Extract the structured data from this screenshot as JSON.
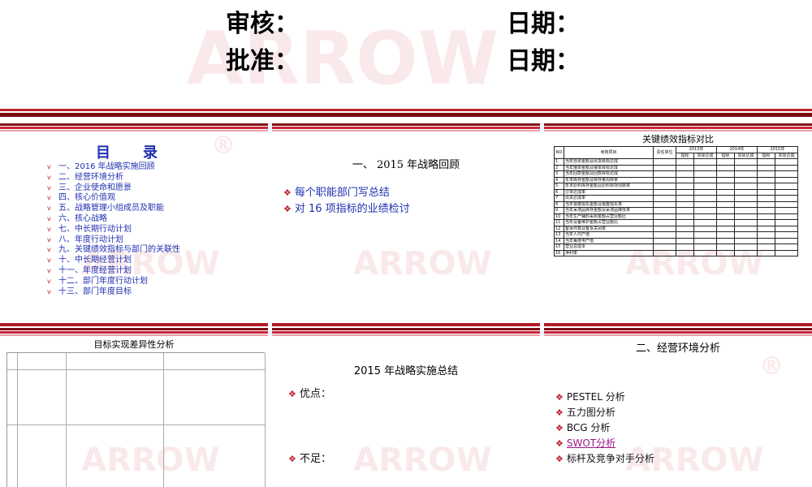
{
  "header": {
    "review_label": "审核：",
    "review_date_label": "日期：",
    "approve_label": "批准：",
    "approve_date_label": "日期："
  },
  "watermark": {
    "brand": "ARROW",
    "mark": "®"
  },
  "toc_slide": {
    "title": "目录",
    "items": [
      "一、2016 年战略实施回顾",
      "二、经营环境分析",
      "三、企业使命和愿景",
      "四、核心价值观",
      "五、战略管理小组成员及职能",
      "六、核心战略",
      "七、中长期行动计划",
      "八、年度行动计划",
      "九、关键绩效指标与部门的关联性",
      "十、中长期经营计划",
      "十一、年度经营计划",
      "十二、部门年度行动计划",
      "十三、部门年度目标"
    ],
    "bullet": "v"
  },
  "review_slide": {
    "title": "一、 2015 年战略回顾",
    "items": [
      "每个职能部门写总结",
      "对 16 项指标的业绩检讨"
    ]
  },
  "kpi_slide": {
    "title": "关键绩效指标对比",
    "headers": {
      "no": "NO",
      "item": "考核项目",
      "owner": "责任单位",
      "years": [
        "2013年",
        "2014年",
        "2015年"
      ],
      "target": "指标",
      "actual": "实际达成"
    },
    "rows": [
      "当年自资金额及出货目标达成",
      "当年接单金额及接单目标达成",
      "当年回款金额及回款目标达成",
      "年末库存金额及库存量周转率",
      "年末原料库存金额及原料库存周转率",
      "订单达成率",
      "出货达成率",
      "当年报废损失金额及报废损失率",
      "当年呆滞品库存金额及呆滞品降低率",
      "当年生产辅料采购金额占营业额比",
      "当年设备维护金额占营业额比",
      "客诉件数及客诉关闭率",
      "当年人均产值",
      "当年每度电产值",
      "营业总成本",
      "净利率"
    ]
  },
  "variance_slide": {
    "title": "目标实现差异性分析"
  },
  "summary_slide": {
    "title": "2015 年战略实施总结",
    "pros_label": "优点：",
    "cons_label": "不足："
  },
  "env_slide": {
    "title": "二、经营环境分析",
    "items": [
      "PESTEL 分析",
      "五力图分析",
      "BCG 分析",
      "SWOT分析",
      "标杆及竞争对手分析"
    ],
    "link_item_index": 3
  },
  "colors": {
    "dark_red": "#7d0b14",
    "red": "#c0202e",
    "blue": "#1f2fb0",
    "link": "#9b1a8a"
  }
}
